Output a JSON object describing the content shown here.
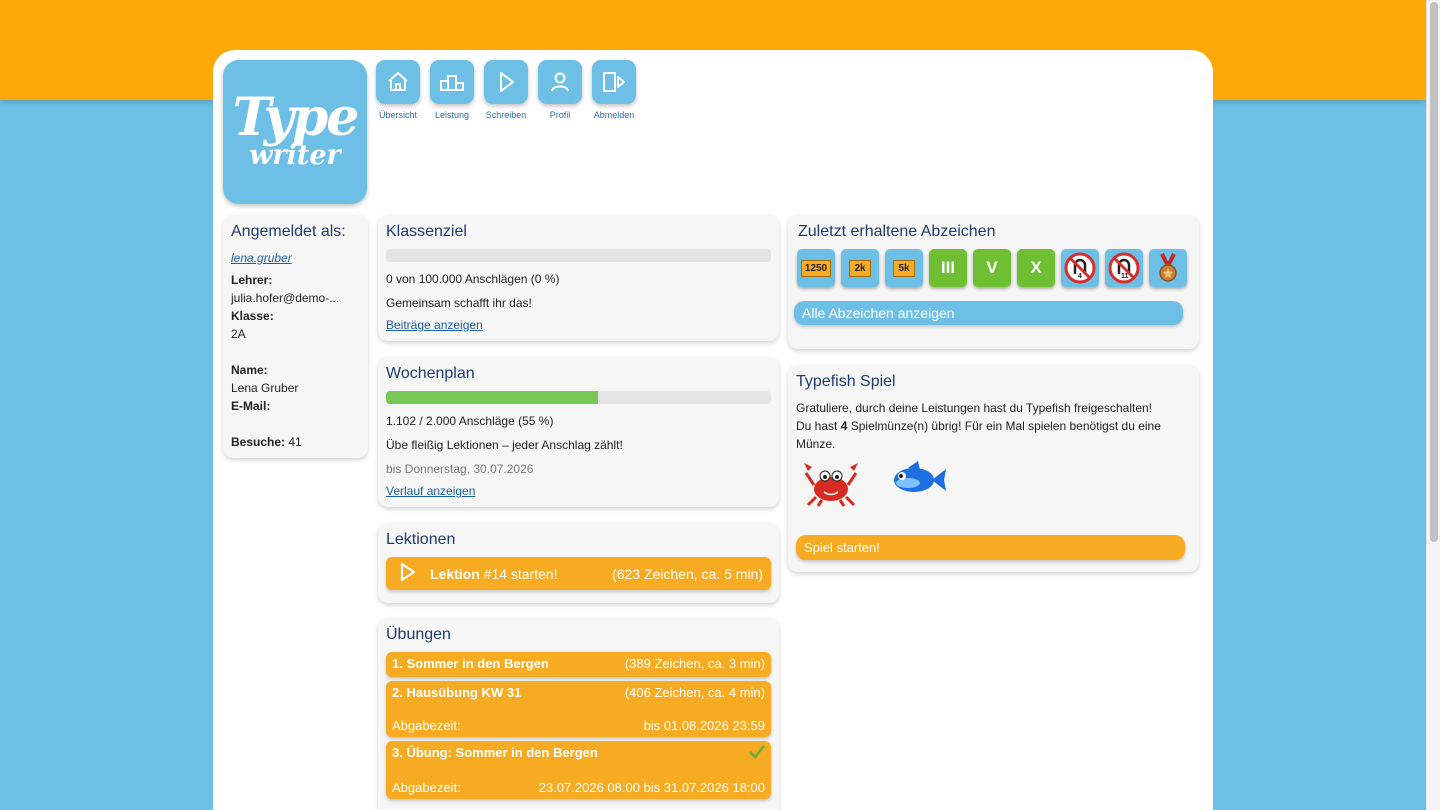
{
  "logo": {
    "line1": "Type",
    "line2": "writer"
  },
  "nav": [
    {
      "label": "Übersicht",
      "icon": "home-icon"
    },
    {
      "label": "Leistung",
      "icon": "podium-icon"
    },
    {
      "label": "Schreiben",
      "icon": "play-icon"
    },
    {
      "label": "Profil",
      "icon": "user-icon"
    },
    {
      "label": "Abmelden",
      "icon": "logout-icon"
    }
  ],
  "user": {
    "heading": "Angemeldet als:",
    "username": "lena.gruber",
    "teacher_label": "Lehrer:",
    "teacher": "julia.hofer@demo-...",
    "class_label": "Klasse:",
    "class": "2A",
    "name_label": "Name:",
    "name": "Lena Gruber",
    "email_label": "E-Mail:",
    "visits_label": "Besuche:",
    "visits": "41"
  },
  "klassenziel": {
    "title": "Klassenziel",
    "progress": 0,
    "stats": "0 von 100.000 Anschlägen  (0 %)",
    "message": "Gemeinsam schafft ihr das!",
    "link": "Beiträge anzeigen"
  },
  "wochenplan": {
    "title": "Wochenplan",
    "progress": 0.55,
    "stats": "1.102 / 2.000 Anschläge  (55 %)",
    "message": "Übe fleißig Lektionen – jeder Anschlag zählt!",
    "deadline": "bis Donnerstag, 30.07.2026",
    "link": "Verlauf anzeigen"
  },
  "lektionen": {
    "title": "Lektionen",
    "button_bold": "Lektion",
    "button_rest": " #14 starten!",
    "button_info": "(623 Zeichen, ca. 5 min)"
  },
  "uebungen": {
    "title": "Übungen",
    "items": [
      {
        "title": "1. Sommer in den Bergen",
        "info": "(389 Zeichen, ca. 3 min)"
      },
      {
        "title": "2. Hausübung KW 31",
        "info": "(406 Zeichen, ca. 4 min)",
        "due_label": "Abgabezeit:",
        "due": "bis 01.08.2026 23:59"
      },
      {
        "title": "3. Übung: Sommer in den Bergen",
        "due_label": "Abgabezeit:",
        "due": "23.07.2026 08:00 bis 31.07.2026 18:00",
        "done": true
      }
    ]
  },
  "abzeichen": {
    "title": "Zuletzt erhaltene Abzeichen",
    "badges": [
      {
        "text": "1250",
        "style": "blue",
        "icon": "flag-badge-icon"
      },
      {
        "text": "2k",
        "style": "blue",
        "icon": "flag-badge-icon"
      },
      {
        "text": "5k",
        "style": "blue",
        "icon": "flag-badge-icon"
      },
      {
        "text": "III",
        "style": "green",
        "icon": "roman-badge-icon"
      },
      {
        "text": "V",
        "style": "green",
        "icon": "roman-badge-icon"
      },
      {
        "text": "X",
        "style": "green",
        "icon": "roman-badge-icon"
      },
      {
        "text": "4",
        "style": "blue",
        "icon": "magnet-badge-icon"
      },
      {
        "text": "11",
        "style": "blue",
        "icon": "magnet-badge-icon"
      },
      {
        "text": "",
        "style": "blue",
        "icon": "medal-badge-icon"
      }
    ],
    "button": "Alle Abzeichen anzeigen"
  },
  "typefish": {
    "title": "Typefish Spiel",
    "line1": "Gratuliere, durch deine Leistungen hast du Typefish freigeschalten!",
    "line2_a": "Du hast ",
    "coins": "4",
    "line2_b": " Spielmünze(n) übrig! Für ein Mal spielen benötigst du eine Münze.",
    "button": "Spiel starten!"
  },
  "colors": {
    "orange": "#ffa80a",
    "blue": "#6dbfe6",
    "green": "#79c757",
    "button_orange": "#f6ab22"
  }
}
